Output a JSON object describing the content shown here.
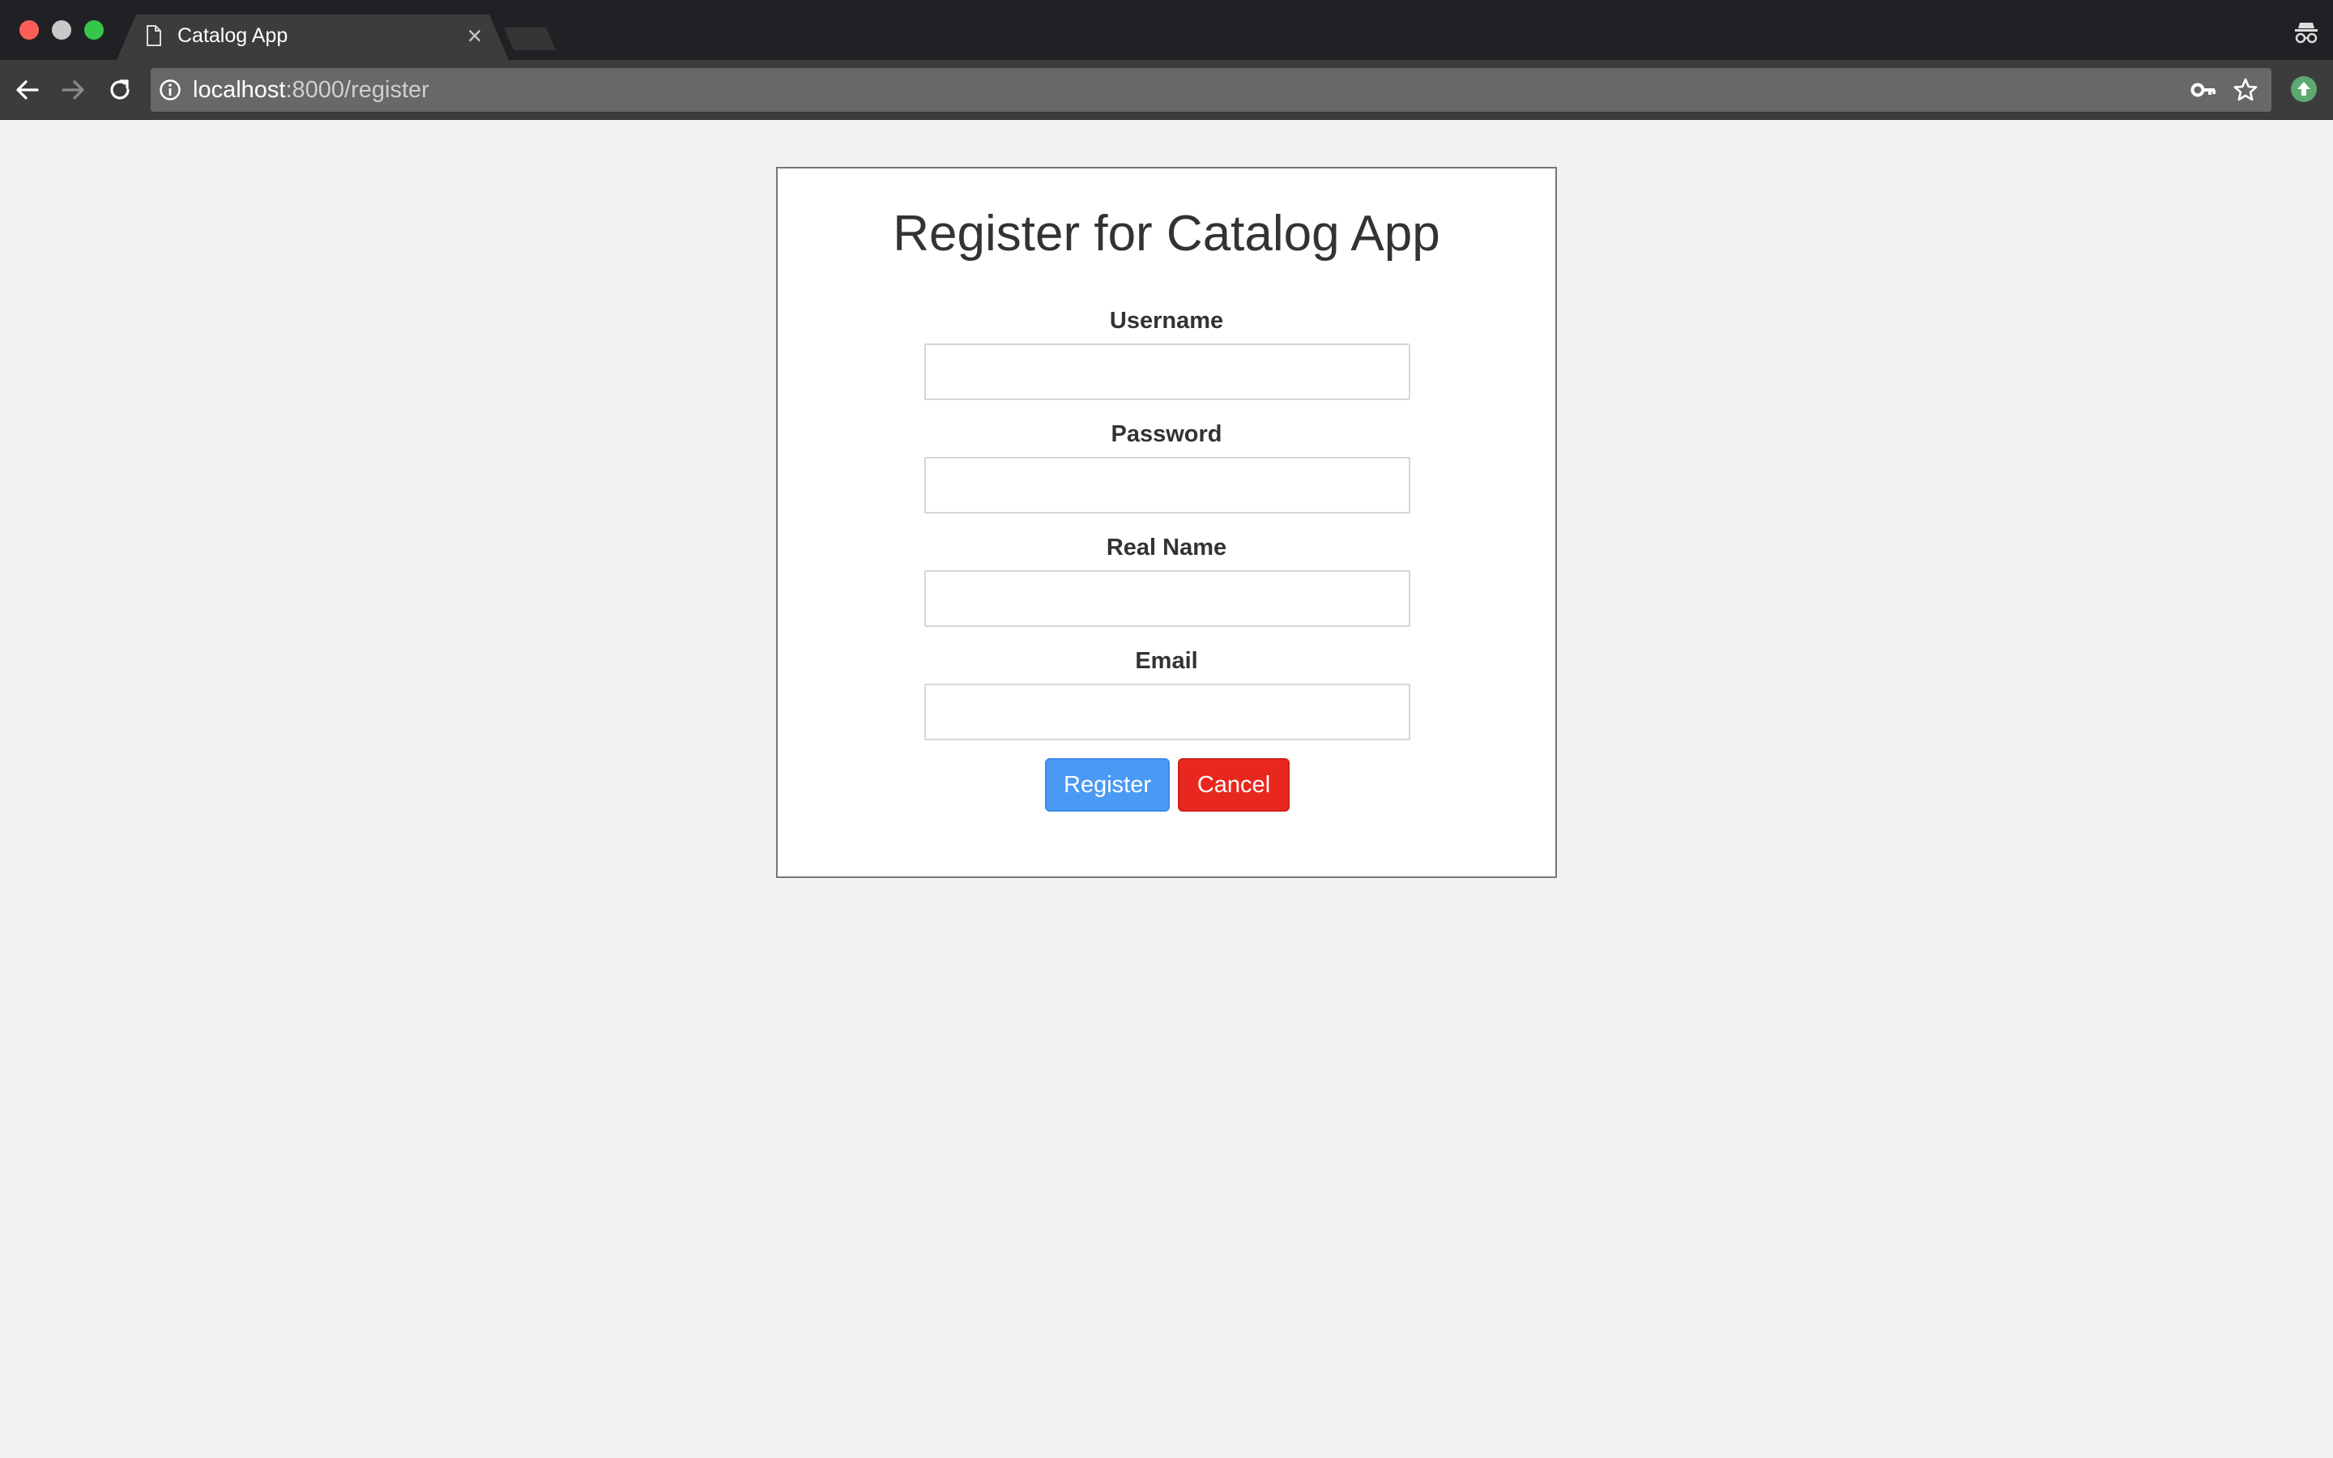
{
  "browser": {
    "tab_title": "Catalog App",
    "tab_close": "×",
    "url_host": "localhost",
    "url_rest": ":8000/register",
    "icons": [
      "back-arrow-icon",
      "forward-arrow-icon",
      "reload-icon",
      "info-icon",
      "key-icon",
      "star-icon",
      "extension-icon",
      "incognito-icon"
    ]
  },
  "page": {
    "title": "Register for Catalog App",
    "fields": [
      {
        "label": "Username",
        "value": "",
        "placeholder": ""
      },
      {
        "label": "Password",
        "value": "",
        "placeholder": ""
      },
      {
        "label": "Real Name",
        "value": "",
        "placeholder": ""
      },
      {
        "label": "Email",
        "value": "",
        "placeholder": ""
      }
    ],
    "register_label": "Register",
    "cancel_label": "Cancel"
  },
  "colors": {
    "background": "#f2f2f2",
    "register_button": "#4a9af5",
    "cancel_button": "#e8281f",
    "chrome_dark": "#202124"
  }
}
